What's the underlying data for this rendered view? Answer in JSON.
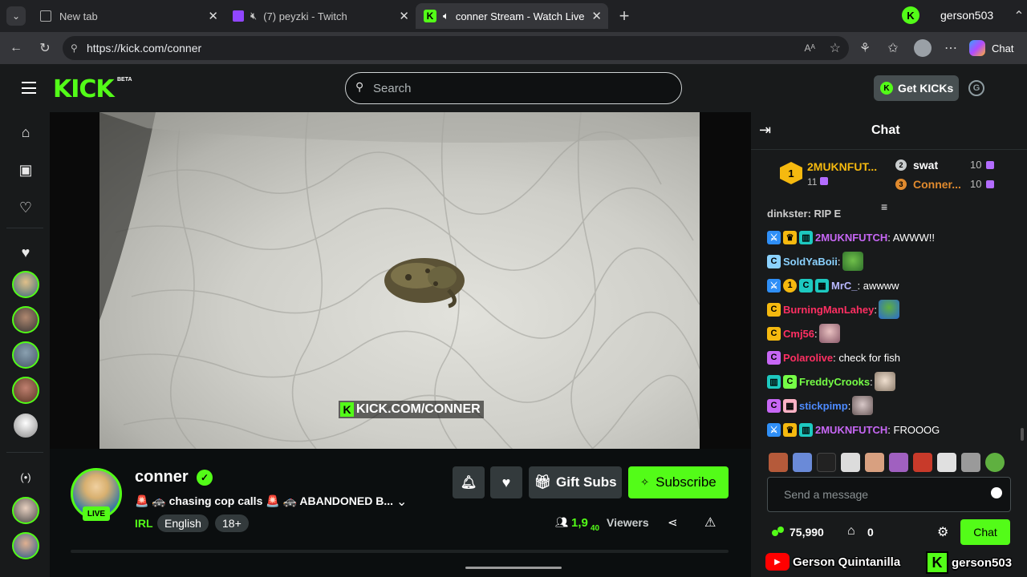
{
  "browser": {
    "tabs": [
      {
        "title": "New tab"
      },
      {
        "title": "(7) peyzki - Twitch"
      },
      {
        "title": "conner Stream - Watch Live o"
      }
    ],
    "profile_name": "gerson503",
    "url": "https://kick.com/conner",
    "chat_button": "Chat"
  },
  "header": {
    "beta_label": "BETA",
    "search_placeholder": "Search",
    "get_kicks": "Get KICKs"
  },
  "video": {
    "watermark": "KICK.COM/CONNER"
  },
  "streamer": {
    "name": "conner",
    "live_badge": "LIVE",
    "title": "🚨 🚓 chasing cop calls 🚨 🚓 ABANDONED B...",
    "category": "IRL",
    "tags": [
      "English",
      "18+"
    ],
    "viewers_count": "1,9",
    "viewers_count_partial": "40",
    "viewers_label": "Viewers",
    "gift_subs": "Gift Subs",
    "subscribe": "Subscribe"
  },
  "chat": {
    "title": "Chat",
    "leaderboard": [
      {
        "rank": "1",
        "name": "2MUKNFUT...",
        "count": "11"
      },
      {
        "rank": "2",
        "name": "swat",
        "count": "10"
      },
      {
        "rank": "3",
        "name": "Conner...",
        "count": "10"
      }
    ],
    "cut_message": "dinkster: RIP E",
    "messages": [
      {
        "user": "2MUKNFUTCH",
        "text": ": AWWW!!",
        "color": "#c767f5"
      },
      {
        "user": "SoldYaBoii",
        "text": ":",
        "color": "#8bd2ff"
      },
      {
        "user": "MrC_",
        "text": ": awwww",
        "color": "#b9b9ff"
      },
      {
        "user": "BurningManLahey",
        "text": ":",
        "color": "#ff2f62"
      },
      {
        "user": "Cmj56",
        "text": ":",
        "color": "#ff2f62"
      },
      {
        "user": "Polarolive",
        "text": ": check for fish",
        "color": "#ff2f62"
      },
      {
        "user": "FreddyCrooks",
        "text": ":",
        "color": "#75fd46"
      },
      {
        "user": "stickpimp",
        "text": ":",
        "color": "#4d8bff"
      },
      {
        "user": "2MUKNFUTCH",
        "text": ": FROOOG",
        "color": "#c767f5"
      }
    ],
    "input_placeholder": "Send a message",
    "points": "75,990",
    "store_count": "0",
    "send_label": "Chat"
  },
  "overlay": {
    "youtube_name": "Gerson Quintanilla",
    "kick_name": "gerson503"
  },
  "colors": {
    "kick_green": "#53fc18",
    "bg": "#0b0e0f",
    "panel": "#181a1b"
  }
}
